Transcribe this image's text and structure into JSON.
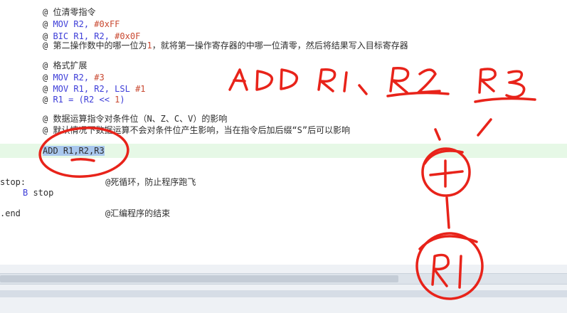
{
  "code": {
    "l1": {
      "prefix": "@ ",
      "text": "位清零指令"
    },
    "l2": {
      "prefix": "@ ",
      "op": "MOV",
      "reg": " R2, ",
      "imm": "#0xFF"
    },
    "l3": {
      "prefix": "@ ",
      "op": "BIC",
      "reg": " R1, R2, ",
      "imm": "#0x0F"
    },
    "l4": {
      "prefix": "@ ",
      "text_a": "第二操作数中的哪一位为",
      "num": "1",
      "text_b": "，就将第一操作寄存器的中哪一位清零，然后将结果写入目标寄存器"
    },
    "l5": {
      "prefix": "@ ",
      "text": "格式扩展"
    },
    "l6": {
      "prefix": "@ ",
      "op": "MOV",
      "reg": " R2, ",
      "imm": "#3"
    },
    "l7": {
      "prefix": "@ ",
      "op": "MOV",
      "reg": " R1, R2, LSL ",
      "imm": "#1"
    },
    "l8": {
      "prefix": "@ ",
      "text": "R1 = (R2 << ",
      "num": "1",
      "suffix": ")"
    },
    "l9": {
      "prefix": "@ ",
      "text": "数据运算指令对条件位（N、Z、C、V）的影响"
    },
    "l10": {
      "prefix": "@ ",
      "text": "默认情况下数据运算不会对条件位产生影响，当在指令后加后缀“S”后可以影响"
    },
    "l11": {
      "op": "ADD",
      "rest": " R1,R2,R3"
    },
    "l12": {
      "label": "stop:",
      "comment": "@死循环，防止程序跑飞"
    },
    "l13": {
      "op": "B",
      "rest": " stop"
    },
    "l14": {
      "label": ".end",
      "comment": "@汇编程序的结束"
    }
  },
  "annotations": {
    "handwriting": "ADD R1、R2 R3",
    "circle_top": "+",
    "circle_bottom": "R1",
    "ink_color": "#e8231a"
  }
}
